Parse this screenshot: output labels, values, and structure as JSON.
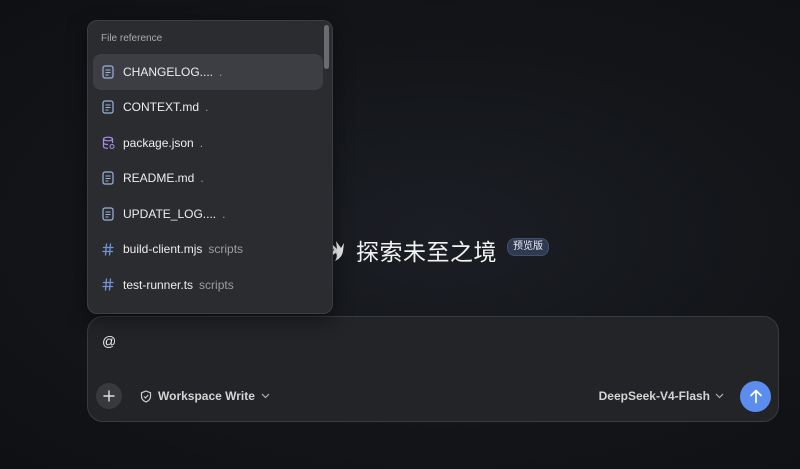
{
  "popup": {
    "header": "File reference",
    "files": [
      {
        "name": "CHANGELOG....",
        "dir": ".",
        "icon": "document-icon",
        "selected": true
      },
      {
        "name": "CONTEXT.md",
        "dir": ".",
        "icon": "document-icon",
        "selected": false
      },
      {
        "name": "package.json",
        "dir": ".",
        "icon": "database-icon",
        "selected": false
      },
      {
        "name": "README.md",
        "dir": ".",
        "icon": "document-icon",
        "selected": false
      },
      {
        "name": "UPDATE_LOG....",
        "dir": ".",
        "icon": "document-icon",
        "selected": false
      },
      {
        "name": "build-client.mjs",
        "dir": "scripts",
        "icon": "hash-icon",
        "selected": false
      },
      {
        "name": "test-runner.ts",
        "dir": "scripts",
        "icon": "hash-icon",
        "selected": false
      }
    ]
  },
  "hero": {
    "title": "探索未至之境",
    "badge": "预览版"
  },
  "composer": {
    "input_value": "@",
    "mode_label": "Workspace Write",
    "model_label": "DeepSeek-V4-Flash"
  },
  "colors": {
    "accent": "#5b8def",
    "doc_icon": "#9ab4dd",
    "db_icon": "#a98be6",
    "hash_icon": "#6f95d6"
  }
}
